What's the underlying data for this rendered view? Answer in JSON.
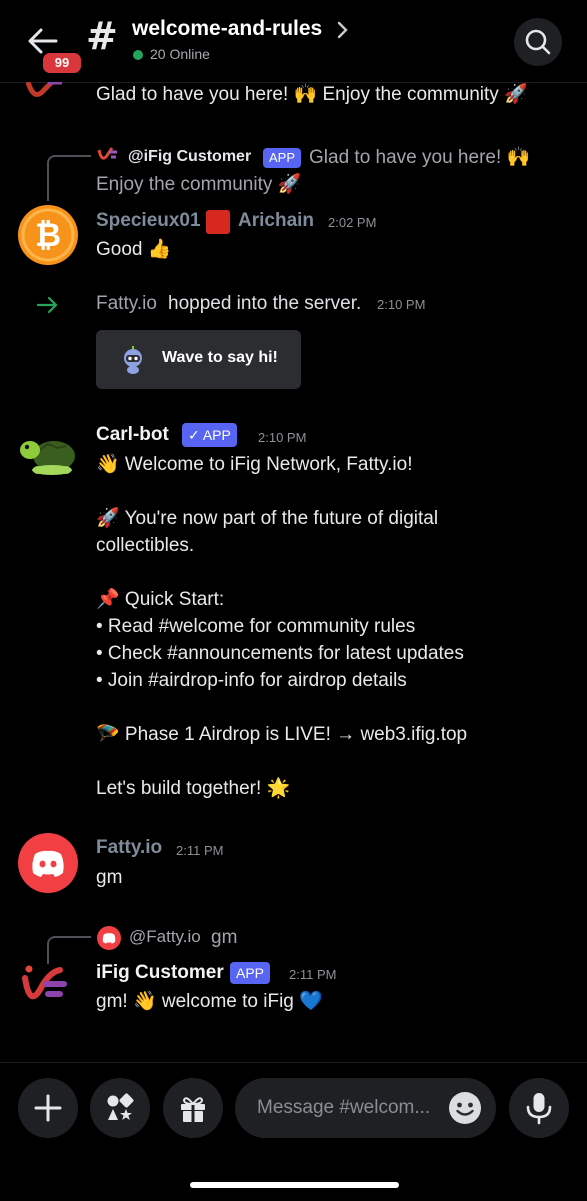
{
  "header": {
    "unread_badge": "99",
    "channel_hash": "#",
    "channel_name": "welcome-and-rules",
    "online": "20 Online"
  },
  "messages": {
    "top_partial_text": "Glad to have you here! 🙌 Enjoy the community 🚀",
    "reply1": {
      "name": "@iFig Customer",
      "tag": "APP",
      "text_line1": "Glad to have you here! 🙌",
      "text_line2": "Enjoy the community 🚀"
    },
    "msg1": {
      "author": "Specieux01",
      "author_suffix": "Arichain",
      "time": "2:02 PM",
      "text": "Good 👍"
    },
    "join": {
      "user": "Fatty.io",
      "text": "hopped into the server.",
      "time": "2:10 PM",
      "wave_label": "Wave to say hi!"
    },
    "carl": {
      "author": "Carl-bot",
      "tag": "✓ APP",
      "time": "2:10 PM",
      "lines": [
        "👋 Welcome to iFig Network, Fatty.io!",
        "🚀 You're now part of the future of digital",
        "collectibles.",
        "📌 Quick Start:",
        "• Read #welcome for community rules",
        "• Check #announcements for latest updates",
        "• Join #airdrop-info for airdrop details",
        "🪂 Phase 1 Airdrop is LIVE! → web3.ifig.top",
        "Let's build together! 🌟"
      ]
    },
    "fatty": {
      "author": "Fatty.io",
      "time": "2:11 PM",
      "text": "gm"
    },
    "reply2": {
      "name": "@Fatty.io",
      "text": "gm"
    },
    "ifig": {
      "author": "iFig Customer",
      "tag": "APP",
      "time": "2:11 PM",
      "text": "gm! 👋 welcome to iFig 💙"
    }
  },
  "composer": {
    "placeholder": "Message #welcom..."
  },
  "colors": {
    "background": "#000000",
    "accent": "#5865f2",
    "online": "#23a55a",
    "badge": "#da373c",
    "discord_red": "#f23f43"
  }
}
